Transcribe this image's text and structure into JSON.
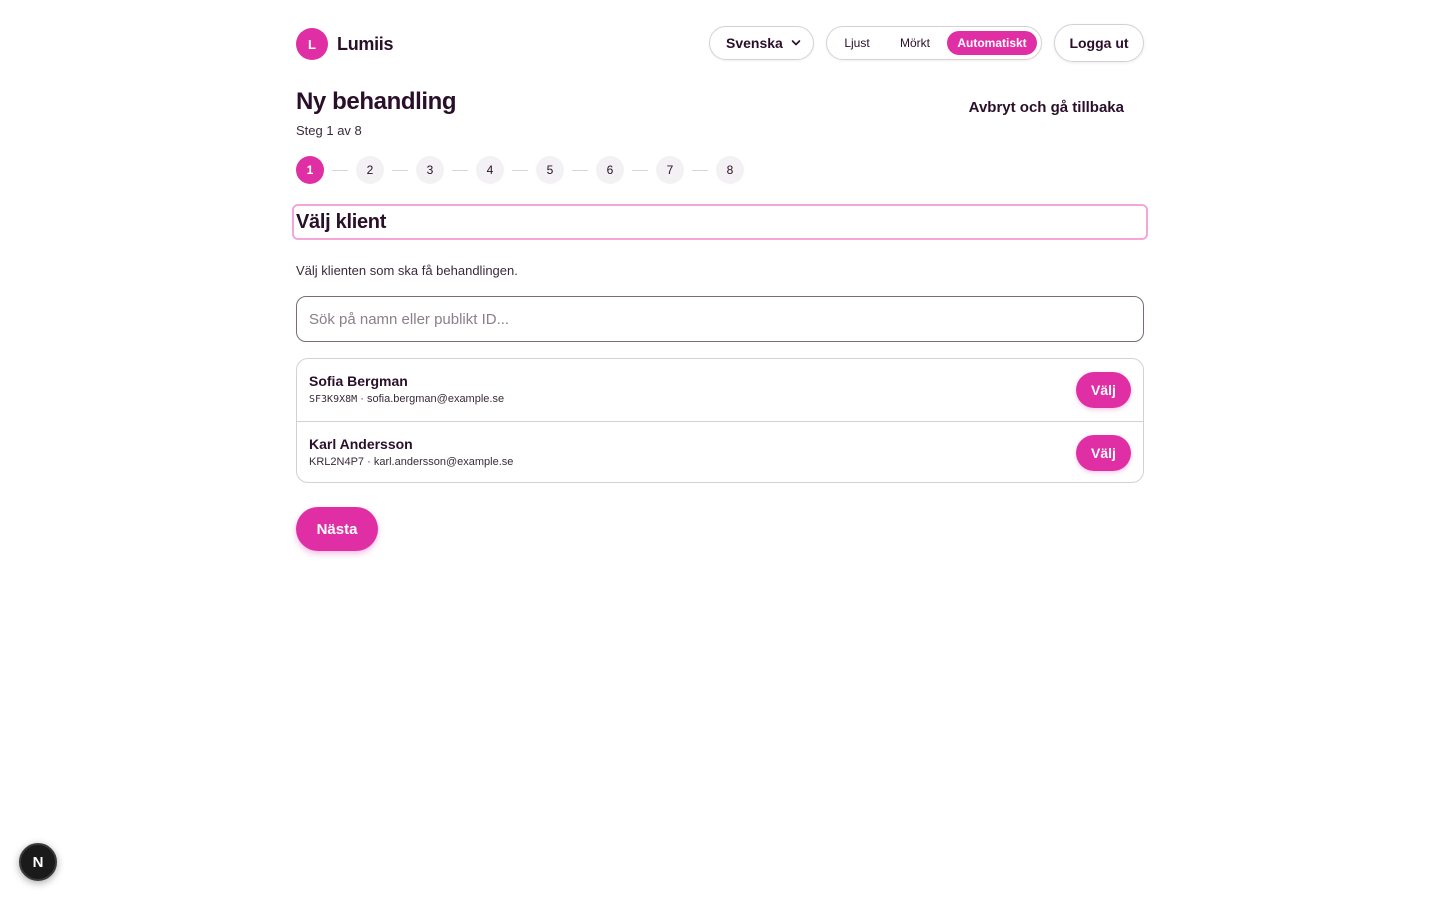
{
  "brand": {
    "logo_letter": "L",
    "name": "Lumiis"
  },
  "header": {
    "language": "Svenska",
    "theme_options": [
      "Ljust",
      "Mörkt",
      "Automatiskt"
    ],
    "theme_active": "Automatiskt",
    "logout_label": "Logga ut"
  },
  "page": {
    "title": "Ny behandling",
    "step_text": "Steg 1 av 8",
    "cancel_label": "Avbryt och gå tillbaka"
  },
  "stepper": {
    "steps": [
      "1",
      "2",
      "3",
      "4",
      "5",
      "6",
      "7",
      "8"
    ],
    "current": 1
  },
  "section": {
    "heading": "Välj klient",
    "description": "Välj klienten som ska få behandlingen."
  },
  "search": {
    "placeholder": "Sök på namn eller publikt ID...",
    "value": ""
  },
  "clients": [
    {
      "name": "Sofia Bergman",
      "public_id": "SF3K9X8M",
      "email": "sofia.bergman@example.se",
      "select_label": "Välj"
    },
    {
      "name": "Karl Andersson",
      "public_id": "KRL2N4P7",
      "email": "karl.andersson@example.se",
      "select_label": "Välj"
    }
  ],
  "next_label": "Nästa",
  "dev_badge": "N",
  "colors": {
    "accent": "#e02fa5",
    "text": "#2a0f2a",
    "focus_outline": "#f4a6da"
  },
  "icons": {
    "language_dropdown": "chevron-down-icon"
  }
}
